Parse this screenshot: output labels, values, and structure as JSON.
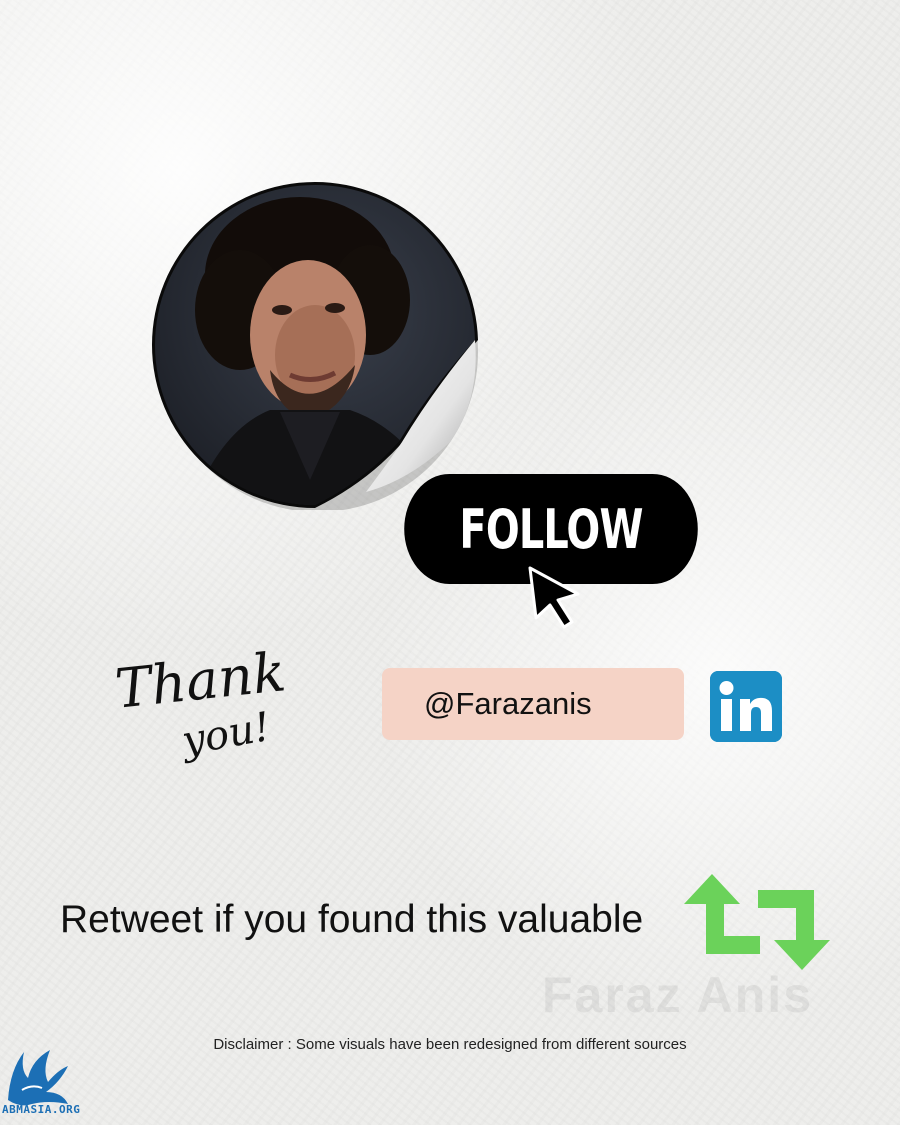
{
  "profile": {
    "image_alt": "profile photo sticker"
  },
  "follow_button": {
    "label": "FOLLOW"
  },
  "thank_you": {
    "line1": "Thank",
    "line2": "you!"
  },
  "social": {
    "handle": "@Farazanis",
    "network_icon": "linkedin-icon"
  },
  "cta": {
    "text": "Retweet if you found this valuable",
    "icon": "retweet-icon"
  },
  "watermark": {
    "text": "Faraz Anis"
  },
  "disclaimer": {
    "text": "Disclaimer : Some visuals have been redesigned from different sources"
  },
  "site_logo": {
    "text": "ABMASIA.ORG"
  },
  "colors": {
    "button_bg": "#000000",
    "handle_pill": "#f5d3c6",
    "linkedin_blue": "#1c8ec5",
    "retweet_green": "#6bd25a"
  }
}
